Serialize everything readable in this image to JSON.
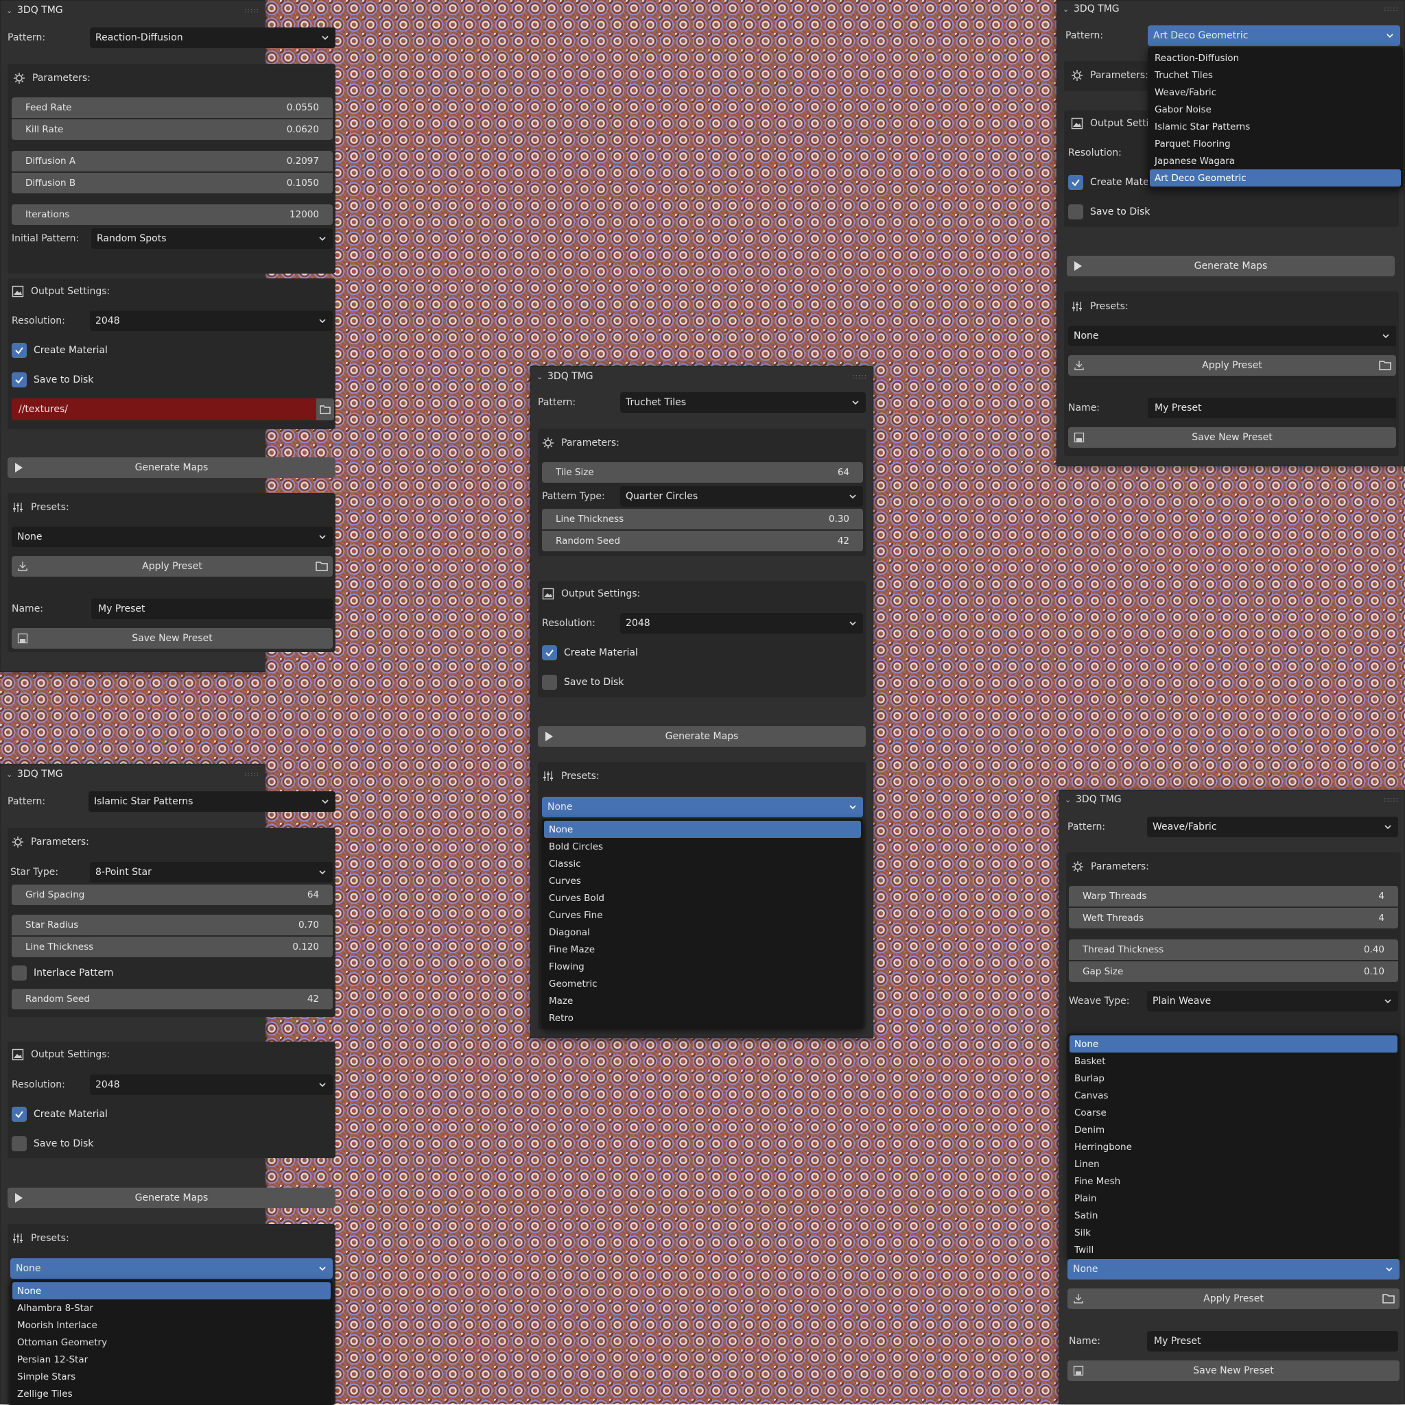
{
  "app_title": "3DQ TMG",
  "labels": {
    "pattern": "Pattern:",
    "parameters": "Parameters:",
    "output_settings": "Output Settings:",
    "resolution": "Resolution:",
    "create_material": "Create Material",
    "save_to_disk": "Save to Disk",
    "generate_maps": "Generate Maps",
    "presets": "Presets:",
    "apply_preset": "Apply Preset",
    "name": "Name:",
    "save_new_preset": "Save New Preset"
  },
  "panel1": {
    "pattern": "Reaction-Diffusion",
    "params": [
      {
        "label": "Feed Rate",
        "value": "0.0550"
      },
      {
        "label": "Kill Rate",
        "value": "0.0620"
      },
      {
        "label": "Diffusion A",
        "value": "0.2097"
      },
      {
        "label": "Diffusion B",
        "value": "0.1050"
      },
      {
        "label": "Iterations",
        "value": "12000"
      }
    ],
    "initial_pattern_label": "Initial Pattern:",
    "initial_pattern": "Random Spots",
    "resolution": "2048",
    "path": "//textures/",
    "preset": "None",
    "name_value": "My Preset"
  },
  "panel2": {
    "pattern": "Art Deco Geometric",
    "pattern_options": [
      "Reaction-Diffusion",
      "Truchet Tiles",
      "Weave/Fabric",
      "Gabor Noise",
      "Islamic Star Patterns",
      "Parquet Flooring",
      "Japanese Wagara",
      "Art Deco Geometric"
    ],
    "output_settings_trunc": "Output Setting",
    "create_material_trunc": "Create Materi",
    "preset": "None",
    "name_value": "My Preset"
  },
  "panel3": {
    "pattern": "Truchet Tiles",
    "tile_size_label": "Tile Size",
    "tile_size": "64",
    "pattern_type_label": "Pattern Type:",
    "pattern_type": "Quarter Circles",
    "line_thickness_label": "Line Thickness",
    "line_thickness": "0.30",
    "random_seed_label": "Random Seed",
    "random_seed": "42",
    "resolution": "2048",
    "preset": "None",
    "preset_options": [
      "None",
      "Bold Circles",
      "Classic",
      "Curves",
      "Curves Bold",
      "Curves Fine",
      "Diagonal",
      "Fine Maze",
      "Flowing",
      "Geometric",
      "Maze",
      "Retro"
    ]
  },
  "panel4": {
    "pattern": "Islamic Star Patterns",
    "star_type_label": "Star Type:",
    "star_type": "8-Point Star",
    "params": [
      {
        "label": "Grid Spacing",
        "value": "64"
      },
      {
        "label": "Star Radius",
        "value": "0.70"
      },
      {
        "label": "Line Thickness",
        "value": "0.120"
      }
    ],
    "interlace_label": "Interlace Pattern",
    "random_seed_label": "Random Seed",
    "random_seed": "42",
    "resolution": "2048",
    "preset": "None",
    "preset_options": [
      "None",
      "Alhambra 8-Star",
      "Moorish Interlace",
      "Ottoman Geometry",
      "Persian 12-Star",
      "Simple Stars",
      "Zellige Tiles"
    ]
  },
  "panel5": {
    "pattern": "Weave/Fabric",
    "params": [
      {
        "label": "Warp Threads",
        "value": "4"
      },
      {
        "label": "Weft Threads",
        "value": "4"
      },
      {
        "label": "Thread Thickness",
        "value": "0.40"
      },
      {
        "label": "Gap Size",
        "value": "0.10"
      }
    ],
    "weave_type_label": "Weave Type:",
    "weave_type": "Plain Weave",
    "preset": "None",
    "preset_options": [
      "None",
      "Basket",
      "Burlap",
      "Canvas",
      "Coarse",
      "Denim",
      "Herringbone",
      "Linen",
      "Fine Mesh",
      "Plain",
      "Satin",
      "Silk",
      "Twill"
    ],
    "name_value": "My Preset"
  },
  "colors": {
    "panel_bg": "#303030",
    "accent": "#4672b3",
    "field": "#545454",
    "input": "#1d1d1d",
    "path_error": "#7a1515"
  }
}
